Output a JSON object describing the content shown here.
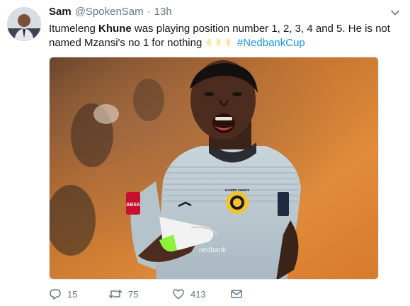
{
  "tweet": {
    "author_name": "Sam",
    "author_handle": "@SpokenSam",
    "separator": "·",
    "time": "13h",
    "text_pre": "Itumeleng ",
    "text_bold": "Khune",
    "text_post": " was playing position number 1, 2, 3, 4 and 5. He is not named Mzansi's no 1 for nothing ",
    "emojis": "✌✌✌",
    "hashtag": "#NedbankCup"
  },
  "media": {
    "crest_text": "KAIZER CHIEFS",
    "sleeve_text": "ABSA",
    "shirt_text": "nedbank"
  },
  "actions": {
    "replies": "15",
    "retweets": "75",
    "likes": "413"
  },
  "colors": {
    "link": "#1b95e0",
    "muted": "#657786",
    "jersey": "#b9c7cf",
    "glove": "#8cf23a",
    "background_orange": "#d9853a"
  },
  "icons": [
    "chevron-down-icon",
    "reply-icon",
    "retweet-icon",
    "like-icon",
    "direct-message-icon"
  ]
}
